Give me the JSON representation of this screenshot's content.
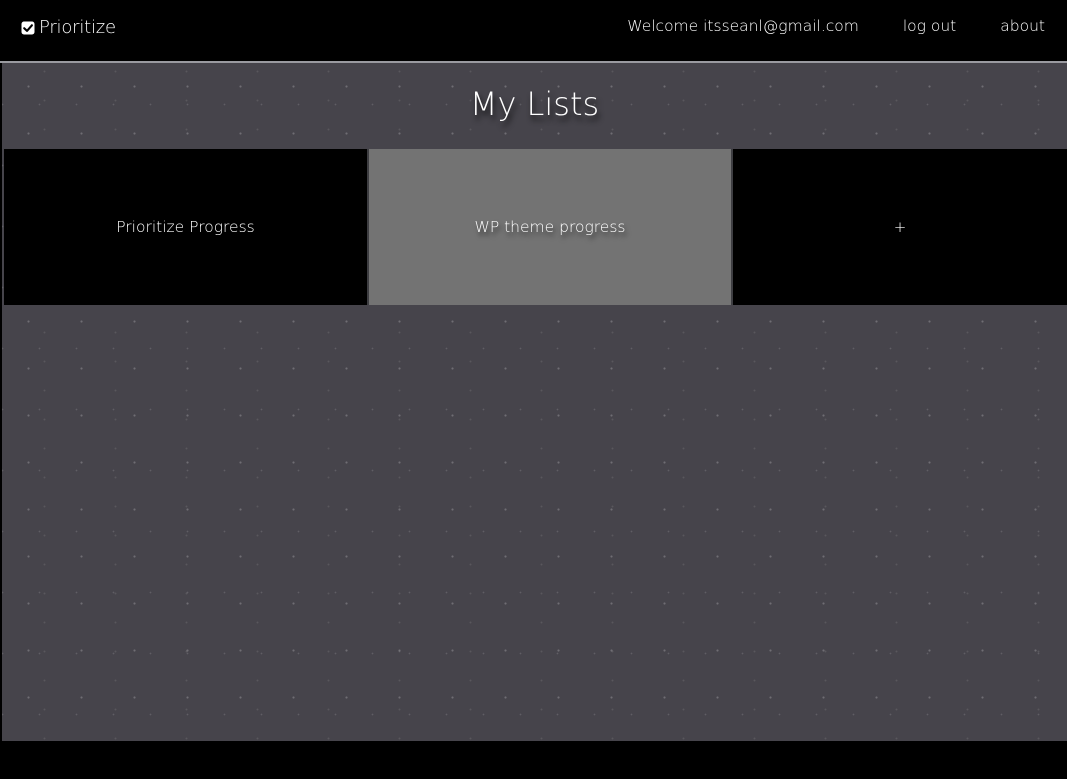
{
  "navbar": {
    "brand_label": "Prioritize",
    "brand_icon": "checkbox-checked-icon",
    "welcome_text": "Welcome itsseanl@gmail.com",
    "logout_label": "log out",
    "about_label": "about"
  },
  "main": {
    "title": "My Lists",
    "lists": [
      {
        "label": "Prioritize Progress",
        "selected": false
      },
      {
        "label": "WP theme progress",
        "selected": true
      }
    ],
    "add_label": "+"
  },
  "colors": {
    "navbar_bg": "#000000",
    "page_bg": "#46444b",
    "tile_bg": "#000000",
    "tile_selected_bg": "#737373",
    "text": "#ffffff"
  }
}
